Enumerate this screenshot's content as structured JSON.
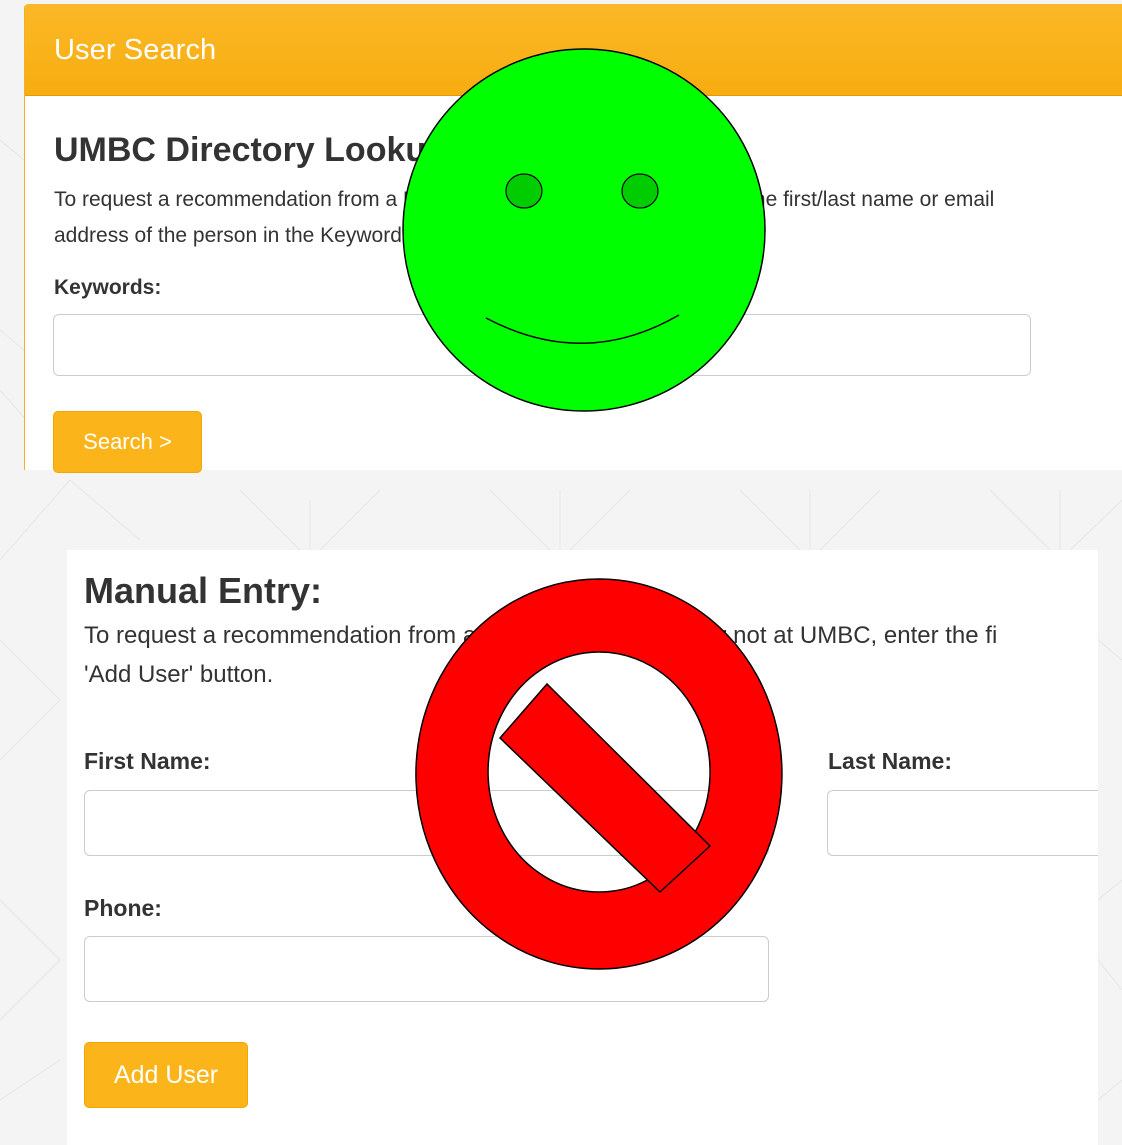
{
  "search_panel": {
    "header_title": "User Search",
    "lookup_title": "UMBC Directory Lookup",
    "lookup_description": "To request a recommendation from a UMBC faculty or staff member, enter the first/last name or email address of the person in the Keywords field and click the 'Search' button.",
    "keywords_label": "Keywords:",
    "keywords_value": "",
    "search_button_label": "Search >"
  },
  "manual_panel": {
    "title": "Manual Entry:",
    "description_line1": "To request a recommendation from a faculty or staff member not at UMBC, enter the fi",
    "description_line2": "'Add User' button.",
    "first_name_label": "First Name:",
    "first_name_value": "",
    "last_name_label": "Last Name:",
    "last_name_value": "",
    "phone_label": "Phone:",
    "phone_value": "",
    "add_button_label": "Add User"
  },
  "overlays": {
    "smiley_icon": "smiley-face-icon",
    "smiley_color": "#00ff00",
    "prohibited_icon": "no-symbol-icon",
    "prohibited_color": "#ff0000"
  },
  "colors": {
    "accent": "#fbb51b",
    "header_gradient_top": "#fbb827",
    "text": "#333333"
  }
}
